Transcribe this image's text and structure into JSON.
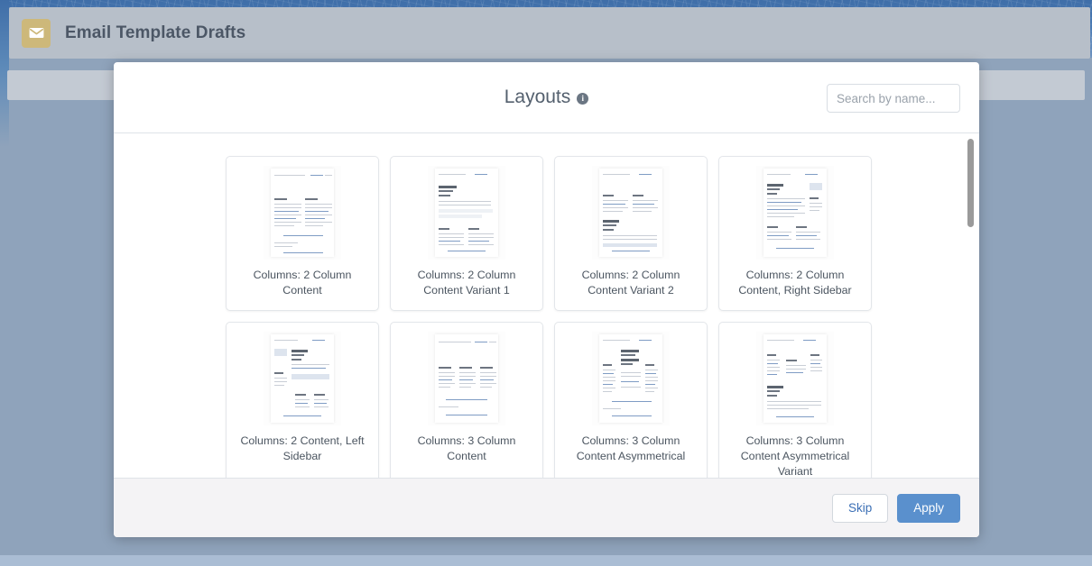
{
  "app": {
    "title": "Email Template Drafts",
    "icon": "envelope-icon"
  },
  "modal": {
    "title": "Layouts",
    "info_icon": "info-icon",
    "info_glyph": "i",
    "search": {
      "placeholder": "Search by name...",
      "value": ""
    },
    "layouts": [
      {
        "label": "Columns: 2 Column Content",
        "thumb": "two-col"
      },
      {
        "label": "Columns: 2 Column Content Variant 1",
        "thumb": "two-col-v1"
      },
      {
        "label": "Columns: 2 Column Content Variant 2",
        "thumb": "two-col-v2"
      },
      {
        "label": "Columns: 2 Column Content, Right Sidebar",
        "thumb": "two-col-right-sidebar"
      },
      {
        "label": "Columns: 2 Content, Left Sidebar",
        "thumb": "two-content-left-sidebar"
      },
      {
        "label": "Columns: 3 Column Content",
        "thumb": "three-col"
      },
      {
        "label": "Columns: 3 Column Content Asymmetrical",
        "thumb": "three-col-asym"
      },
      {
        "label": "Columns: 3 Column Content Asymmetrical Variant",
        "thumb": "three-col-asym-variant"
      }
    ],
    "footer": {
      "skip_label": "Skip",
      "apply_label": "Apply"
    }
  },
  "colors": {
    "brand_blue": "#5a90cd",
    "header_bar": "#b7bfc9",
    "backdrop": "#8fa3bb",
    "app_icon": "#cdb87a",
    "link_blue": "#3b6fb5"
  }
}
